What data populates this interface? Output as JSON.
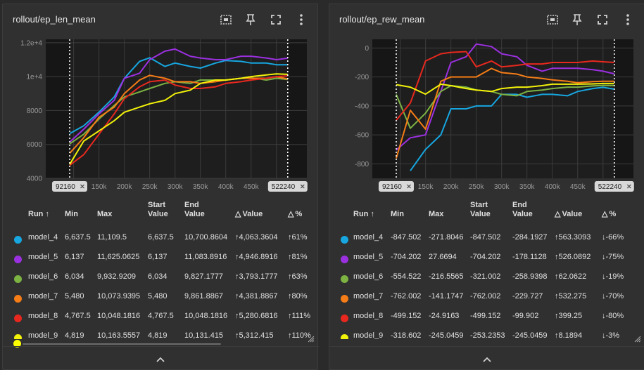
{
  "colors": {
    "bg": "#303030",
    "plot_bg": "#1e1e1e",
    "grid": "#3c3c3c",
    "tick": "#9a9a9a",
    "marker_box": "#d8d8d8"
  },
  "series_colors": {
    "model_4": "#17a6e0",
    "model_5": "#9b30e0",
    "model_6": "#7cb342",
    "model_7": "#f57c16",
    "model_8": "#e8281e",
    "model_9": "#f2f20a"
  },
  "table_headers": {
    "run": "Run",
    "min": "Min",
    "max": "Max",
    "start": "Start Value",
    "end": "End Value",
    "dvalue": "Value",
    "dpct": "%"
  },
  "charts": [
    {
      "title": "rollout/ep_len_mean",
      "marker_left": "92160",
      "marker_right": "522240",
      "chart_data": {
        "type": "line",
        "title": "rollout/ep_len_mean",
        "xlim": [
          45000,
          560000
        ],
        "ylim": [
          4000,
          12200
        ],
        "x_ticks": [
          {
            "v": 100000,
            "label": "100k"
          },
          {
            "v": 150000,
            "label": "150k"
          },
          {
            "v": 200000,
            "label": "200k"
          },
          {
            "v": 250000,
            "label": "250k"
          },
          {
            "v": 300000,
            "label": "300k"
          },
          {
            "v": 350000,
            "label": "350k"
          },
          {
            "v": 400000,
            "label": "400k"
          },
          {
            "v": 450000,
            "label": "450k"
          },
          {
            "v": 500000,
            "label": "500k"
          }
        ],
        "y_ticks": [
          {
            "v": 4000,
            "label": "4000"
          },
          {
            "v": 6000,
            "label": "6000"
          },
          {
            "v": 8000,
            "label": "8000"
          },
          {
            "v": 10000,
            "label": "1e+4"
          },
          {
            "v": 12000,
            "label": "1.2e+4"
          }
        ],
        "x": [
          92160,
          120000,
          150000,
          180000,
          200000,
          230000,
          250000,
          280000,
          300000,
          330000,
          350000,
          380000,
          400000,
          430000,
          450000,
          480000,
          500000,
          522240
        ],
        "series": [
          {
            "name": "model_4",
            "values": [
              6637.5,
              7100,
              7900,
              8800,
              9900,
              10900,
              11109.5,
              10600,
              10800,
              10600,
              10500,
              10800,
              10950,
              10900,
              10800,
              10800,
              10700,
              10700.8604
            ]
          },
          {
            "name": "model_5",
            "values": [
              6137,
              6900,
              7800,
              8600,
              9900,
              10200,
              11000,
              11500,
              11625.0625,
              11200,
              11100,
              11000,
              11000,
              11200,
              11200,
              11100,
              11000,
              11083.8916
            ]
          },
          {
            "name": "model_6",
            "values": [
              6034,
              6600,
              7500,
              8300,
              8800,
              9100,
              9300,
              9600,
              9700,
              9600,
              9800,
              9800,
              9800,
              9900,
              9932.9209,
              9800,
              9900,
              9827.1777
            ]
          },
          {
            "name": "model_7",
            "values": [
              5480,
              6400,
              7600,
              8200,
              9000,
              9800,
              10073.9395,
              9900,
              9700,
              9700,
              9600,
              9700,
              9800,
              9900,
              9900,
              9900,
              10000,
              9861.8867
            ]
          },
          {
            "name": "model_8",
            "values": [
              4767.5,
              5400,
              6600,
              7800,
              8700,
              9400,
              9700,
              9800,
              9500,
              9300,
              9300,
              9400,
              9600,
              9700,
              9800,
              9900,
              10000,
              10048.1816
            ]
          },
          {
            "name": "model_9",
            "values": [
              4819,
              6200,
              6800,
              7400,
              7900,
              8200,
              8400,
              8600,
              9000,
              9200,
              9600,
              9800,
              9800,
              9900,
              10000,
              10100,
              10163.5557,
              10131.415
            ]
          }
        ]
      },
      "rows": [
        {
          "name": "model_4",
          "min": "6,637.5",
          "max": "11,109.5",
          "start": "6,637.5",
          "end": "10,700.8604",
          "dvalue": "4,063.3604",
          "dpct": "61%",
          "dir": "up"
        },
        {
          "name": "model_5",
          "min": "6,137",
          "max": "11,625.0625",
          "start": "6,137",
          "end": "11,083.8916",
          "dvalue": "4,946.8916",
          "dpct": "81%",
          "dir": "up"
        },
        {
          "name": "model_6",
          "min": "6,034",
          "max": "9,932.9209",
          "start": "6,034",
          "end": "9,827.1777",
          "dvalue": "3,793.1777",
          "dpct": "63%",
          "dir": "up"
        },
        {
          "name": "model_7",
          "min": "5,480",
          "max": "10,073.9395",
          "start": "5,480",
          "end": "9,861.8867",
          "dvalue": "4,381.8867",
          "dpct": "80%",
          "dir": "up"
        },
        {
          "name": "model_8",
          "min": "4,767.5",
          "max": "10,048.1816",
          "start": "4,767.5",
          "end": "10,048.1816",
          "dvalue": "5,280.6816",
          "dpct": "111%",
          "dir": "up"
        },
        {
          "name": "model_9",
          "min": "4,819",
          "max": "10,163.5557",
          "start": "4,819",
          "end": "10,131.415",
          "dvalue": "5,312.415",
          "dpct": "110%",
          "dir": "up"
        }
      ]
    },
    {
      "title": "rollout/ep_rew_mean",
      "marker_left": "92160",
      "marker_right": "522240",
      "chart_data": {
        "type": "line",
        "title": "rollout/ep_rew_mean",
        "xlim": [
          45000,
          560000
        ],
        "ylim": [
          -900,
          60
        ],
        "x_ticks": [
          {
            "v": 100000,
            "label": "100k"
          },
          {
            "v": 150000,
            "label": "150k"
          },
          {
            "v": 200000,
            "label": "200k"
          },
          {
            "v": 250000,
            "label": "250k"
          },
          {
            "v": 300000,
            "label": "300k"
          },
          {
            "v": 350000,
            "label": "350k"
          },
          {
            "v": 400000,
            "label": "400k"
          },
          {
            "v": 450000,
            "label": "450k"
          },
          {
            "v": 500000,
            "label": "500k"
          }
        ],
        "y_ticks": [
          {
            "v": 0,
            "label": "0"
          },
          {
            "v": -200,
            "label": "-200"
          },
          {
            "v": -400,
            "label": "-400"
          },
          {
            "v": -600,
            "label": "-600"
          },
          {
            "v": -800,
            "label": "-800"
          }
        ],
        "x": [
          92160,
          120000,
          150000,
          180000,
          200000,
          230000,
          250000,
          280000,
          300000,
          330000,
          350000,
          380000,
          400000,
          430000,
          450000,
          480000,
          500000,
          522240
        ],
        "series": [
          {
            "name": "model_4",
            "values": [
              null,
              -847.502,
              -700,
              -600,
              -420,
              -420,
              -400,
              -400,
              -320,
              -320,
              -340,
              -320,
              -320,
              -330,
              -300,
              -280,
              -271.8046,
              -284.1927
            ]
          },
          {
            "name": "model_5",
            "values": [
              -704.202,
              -620,
              -600,
              -300,
              -100,
              -60,
              27.6694,
              10,
              -40,
              -60,
              -120,
              -160,
              -140,
              -140,
              -140,
              -150,
              -160,
              -178.1128
            ]
          },
          {
            "name": "model_6",
            "values": [
              -321.002,
              -554.522,
              -450,
              -300,
              -260,
              -270,
              -290,
              -300,
              -320,
              -330,
              -300,
              -290,
              -280,
              -270,
              -270,
              -262,
              -258,
              -258.9398
            ]
          },
          {
            "name": "model_7",
            "values": [
              -762.002,
              -430,
              -560,
              -230,
              -200,
              -200,
              -200,
              -141.1747,
              -170,
              -180,
              -200,
              -210,
              -220,
              -230,
              -240,
              -232,
              -230,
              -229.727
            ]
          },
          {
            "name": "model_8",
            "values": [
              -499.152,
              -380,
              -90,
              -40,
              -30,
              -24.9163,
              -130,
              -90,
              -130,
              -120,
              -110,
              -110,
              -100,
              -100,
              -100,
              -90,
              -95,
              -99.902
            ]
          },
          {
            "name": "model_9",
            "values": [
              -253.2353,
              -270,
              -318.602,
              -250,
              -260,
              -280,
              -290,
              -300,
              -280,
              -270,
              -270,
              -260,
              -250,
              -250,
              -250,
              -248,
              -245,
              -245.0459
            ]
          }
        ]
      },
      "rows": [
        {
          "name": "model_4",
          "min": "-847.502",
          "max": "-271.8046",
          "start": "-847.502",
          "end": "-284.1927",
          "dvalue": "563.3093",
          "dpct": "-66%",
          "dir": "up",
          "pdir": "down"
        },
        {
          "name": "model_5",
          "min": "-704.202",
          "max": "27.6694",
          "start": "-704.202",
          "end": "-178.1128",
          "dvalue": "526.0892",
          "dpct": "-75%",
          "dir": "up",
          "pdir": "down"
        },
        {
          "name": "model_6",
          "min": "-554.522",
          "max": "-216.5565",
          "start": "-321.002",
          "end": "-258.9398",
          "dvalue": "62.0622",
          "dpct": "-19%",
          "dir": "up",
          "pdir": "down"
        },
        {
          "name": "model_7",
          "min": "-762.002",
          "max": "-141.1747",
          "start": "-762.002",
          "end": "-229.727",
          "dvalue": "532.275",
          "dpct": "-70%",
          "dir": "up",
          "pdir": "down"
        },
        {
          "name": "model_8",
          "min": "-499.152",
          "max": "-24.9163",
          "start": "-499.152",
          "end": "-99.902",
          "dvalue": "399.25",
          "dpct": "-80%",
          "dir": "up",
          "pdir": "down"
        },
        {
          "name": "model_9",
          "min": "-318.602",
          "max": "-245.0459",
          "start": "-253.2353",
          "end": "-245.0459",
          "dvalue": "8.1894",
          "dpct": "-3%",
          "dir": "up",
          "pdir": "down"
        }
      ]
    }
  ]
}
